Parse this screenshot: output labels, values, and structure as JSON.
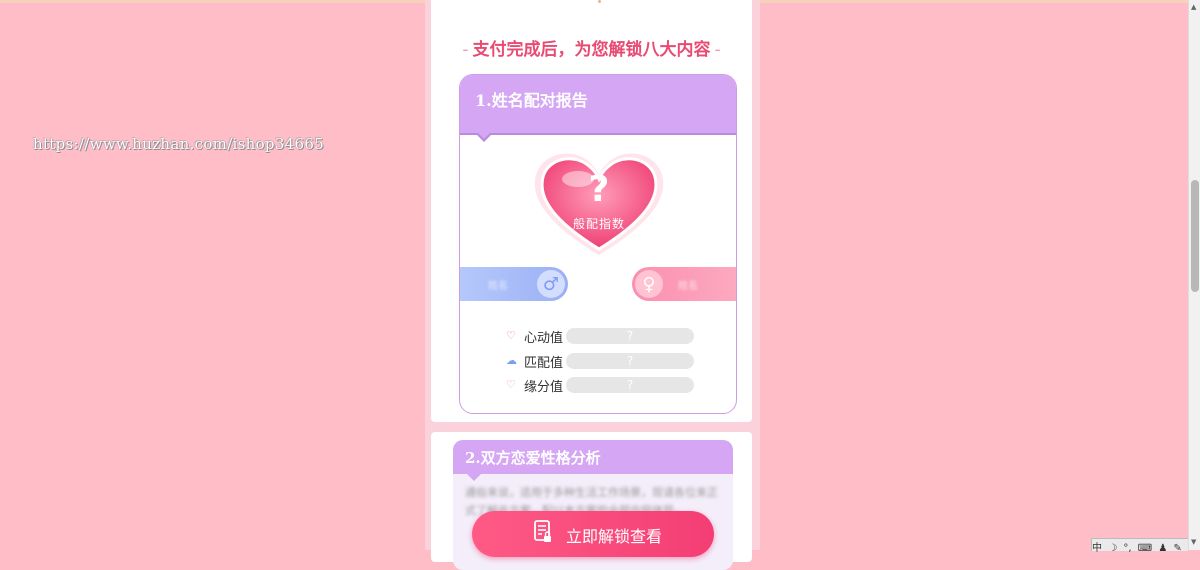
{
  "watermark": "https://www.huzhan.com/ishop34665",
  "section_title": "支付完成后，为您解锁八大内容",
  "section_dash": "-",
  "report1": {
    "title": "1.姓名配对报告",
    "heart_symbol": "?",
    "heart_label": "般配指数",
    "male_name": "姓名",
    "female_name": "姓名",
    "male_symbol": "♂",
    "female_symbol": "♀",
    "rows": [
      {
        "label": "心动值",
        "value": "?",
        "icon": "heart-icon"
      },
      {
        "label": "匹配值",
        "value": "?",
        "icon": "cloud-icon"
      },
      {
        "label": "缘分值",
        "value": "?",
        "icon": "heart-outline-icon"
      }
    ]
  },
  "report2": {
    "title": "2.双方恋爱性格分析",
    "preview_text": "通俗来说，适用于多种生活工作场景，现请各位来正式了解此方案，配以本方案的全部内容体现。"
  },
  "unlock_button": "立即解锁查看",
  "ime": {
    "items": [
      "中",
      "☽",
      "°,",
      "⌨",
      "♟",
      "✎"
    ]
  },
  "colors": {
    "background": "#ffbdc8",
    "accent": "#e84a72",
    "purple_header": "#d4a6f4",
    "button": "#f33e74"
  }
}
